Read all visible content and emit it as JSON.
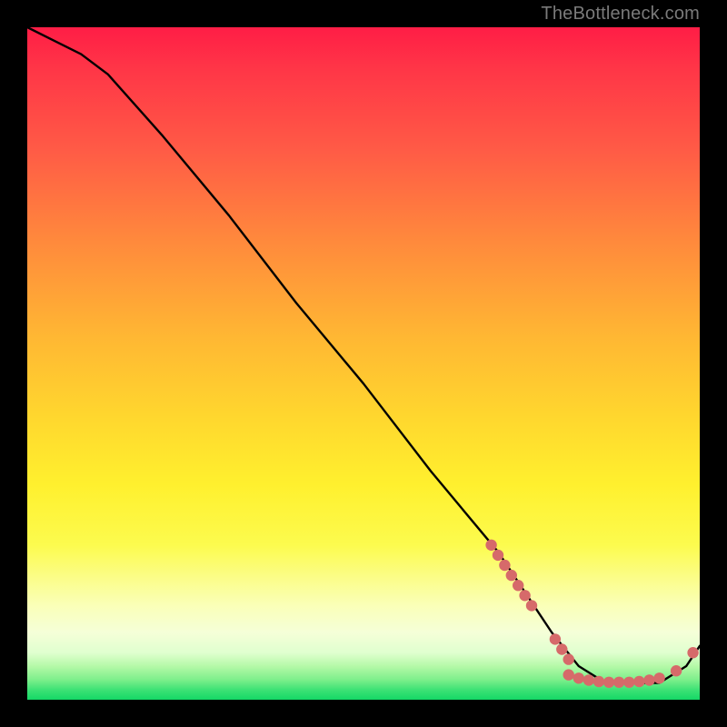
{
  "watermark": "TheBottleneck.com",
  "chart_data": {
    "type": "line",
    "title": "",
    "xlabel": "",
    "ylabel": "",
    "xlim": [
      0,
      100
    ],
    "ylim": [
      0,
      100
    ],
    "grid": false,
    "legend": false,
    "series": [
      {
        "name": "bottleneck-curve",
        "color": "#000000",
        "x": [
          0,
          4,
          8,
          12,
          20,
          30,
          40,
          50,
          60,
          70,
          74,
          78,
          82,
          86,
          90,
          94,
          98,
          100
        ],
        "y": [
          100,
          98,
          96,
          93,
          84,
          72,
          59,
          47,
          34,
          22,
          16,
          10,
          5,
          2.5,
          2.5,
          2.5,
          5,
          8
        ]
      }
    ],
    "marker_clusters": [
      {
        "name": "slope-markers",
        "color": "#d66a6a",
        "points_xy": [
          [
            69,
            23
          ],
          [
            70,
            21.5
          ],
          [
            71,
            20
          ],
          [
            72,
            18.5
          ],
          [
            73,
            17
          ],
          [
            74,
            15.5
          ],
          [
            75,
            14
          ],
          [
            78.5,
            9
          ],
          [
            79.5,
            7.5
          ],
          [
            80.5,
            6
          ]
        ]
      },
      {
        "name": "valley-markers",
        "color": "#d66a6a",
        "points_xy": [
          [
            80.5,
            3.7
          ],
          [
            82,
            3.2
          ],
          [
            83.5,
            2.9
          ],
          [
            85,
            2.7
          ],
          [
            86.5,
            2.6
          ],
          [
            88,
            2.6
          ],
          [
            89.5,
            2.6
          ],
          [
            91,
            2.7
          ],
          [
            92.5,
            2.9
          ],
          [
            94,
            3.2
          ]
        ]
      },
      {
        "name": "right-markers",
        "color": "#d66a6a",
        "points_xy": [
          [
            96.5,
            4.3
          ],
          [
            99,
            7
          ]
        ]
      }
    ],
    "background_gradient": {
      "top": "#ff1d46",
      "upper_mid": "#ffb733",
      "mid": "#fff02e",
      "lower_mid": "#faffb8",
      "bottom": "#14d866"
    }
  }
}
